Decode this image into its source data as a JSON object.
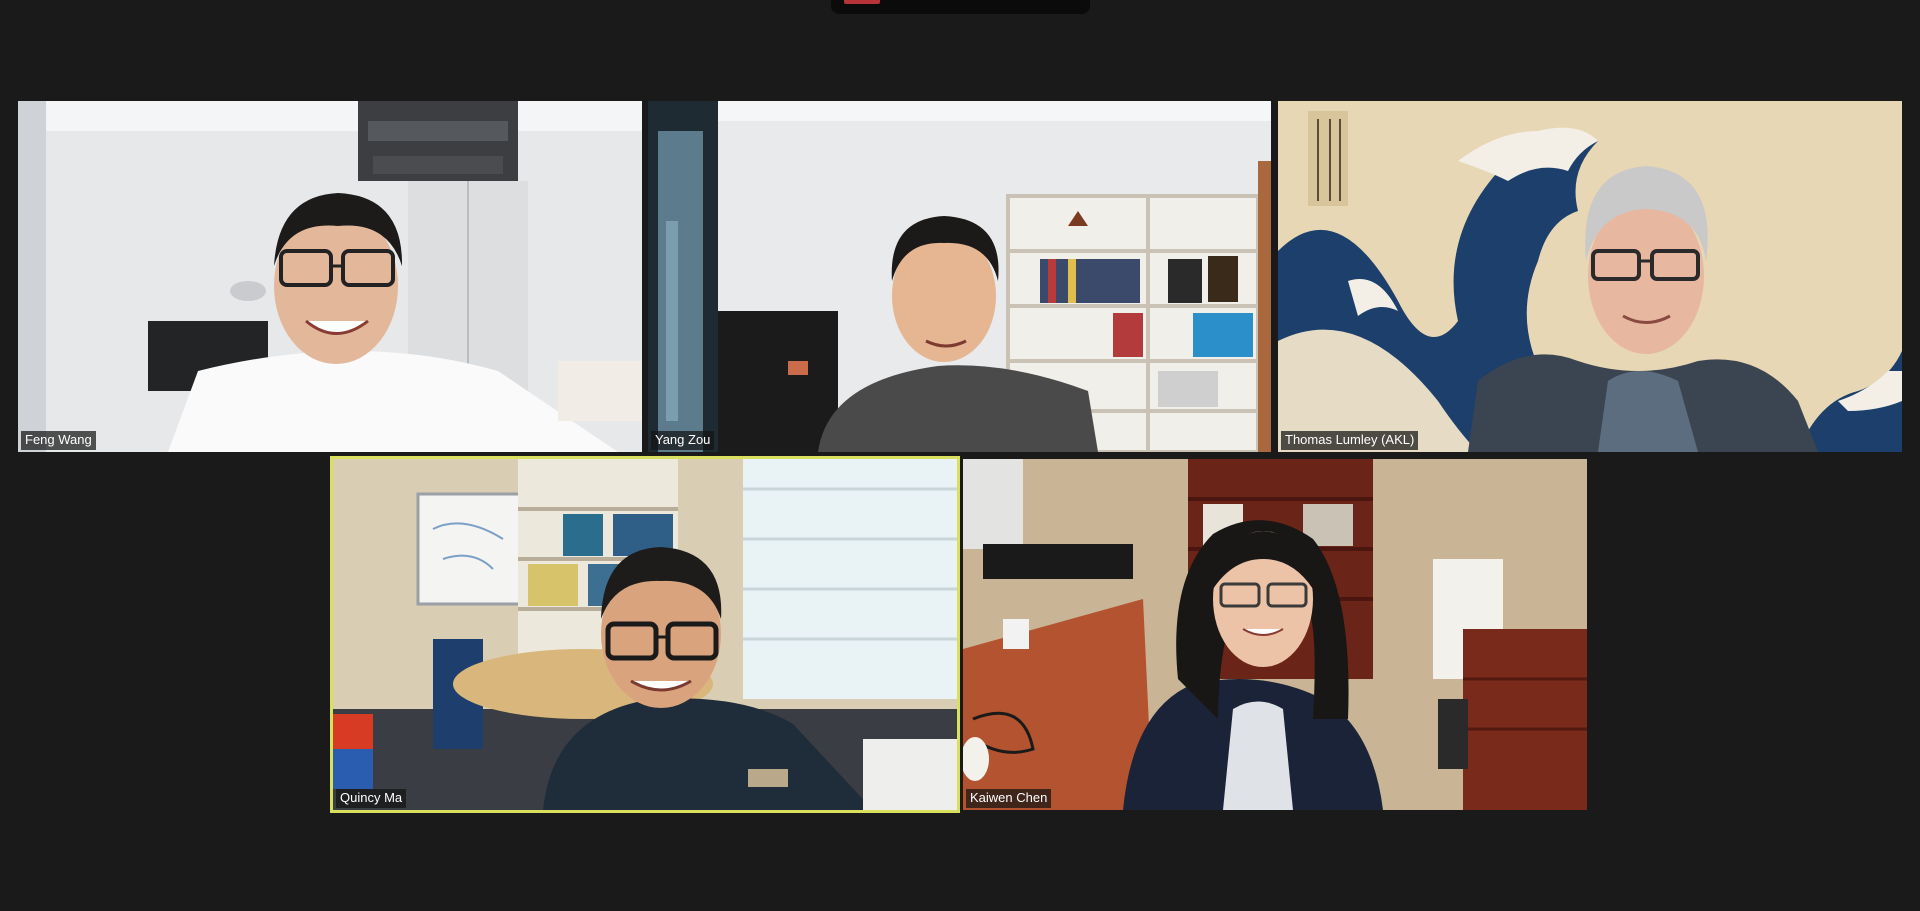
{
  "meeting": {
    "participants": [
      {
        "name": "Feng Wang"
      },
      {
        "name": "Yang Zou"
      },
      {
        "name": "Thomas Lumley (AKL)"
      },
      {
        "name": "Quincy Ma",
        "active_speaker": true
      },
      {
        "name": "Kaiwen Chen"
      }
    ]
  },
  "colors": {
    "background": "#1a1a1a",
    "active_speaker_border": "#d8e05e",
    "name_tag_bg": "#141414"
  }
}
